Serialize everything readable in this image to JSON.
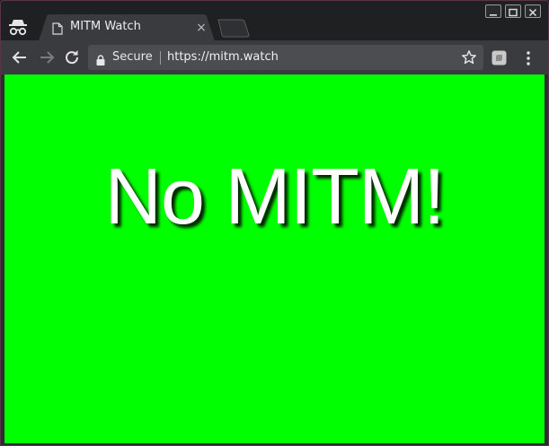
{
  "browser": {
    "tab": {
      "title": "MITM Watch",
      "close_glyph": "×",
      "favicon": "document-icon"
    },
    "toolbar": {
      "security_label": "Secure",
      "url": "https://mitm.watch",
      "icons": [
        "back-arrow-icon",
        "forward-arrow-icon",
        "reload-icon",
        "lock-icon",
        "star-icon",
        "extension-icon",
        "kebab-menu-icon"
      ]
    },
    "window_controls": [
      "minimize-icon",
      "maximize-icon",
      "close-icon"
    ],
    "mode": "incognito"
  },
  "page": {
    "headline": "No MITM!",
    "background_color": "#00ff00",
    "text_color": "#ffffff"
  }
}
